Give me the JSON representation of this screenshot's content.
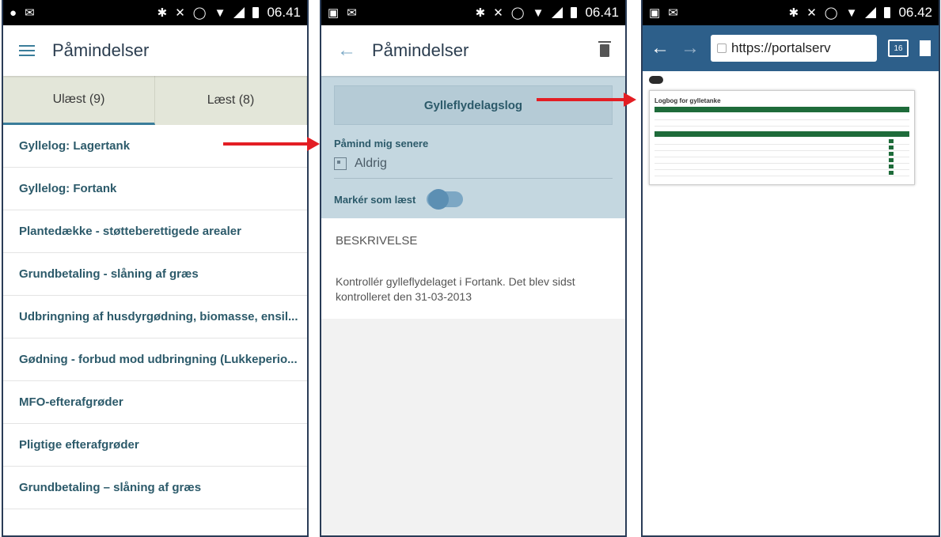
{
  "phone1": {
    "status": {
      "time": "06.41"
    },
    "appbar": {
      "title": "Påmindelser"
    },
    "tabs": [
      {
        "label": "Ulæst (9)"
      },
      {
        "label": "Læst (8)"
      }
    ],
    "items": [
      {
        "label": "Gyllelog: Lagertank"
      },
      {
        "label": "Gyllelog: Fortank"
      },
      {
        "label": "Plantedække - støtteberettigede arealer"
      },
      {
        "label": "Grundbetaling - slåning af græs"
      },
      {
        "label": "Udbringning af husdyrgødning, biomasse, ensil..."
      },
      {
        "label": "Gødning - forbud mod udbringning (Lukkeperio..."
      },
      {
        "label": "MFO-efterafgrøder"
      },
      {
        "label": "Pligtige efterafgrøder"
      },
      {
        "label": "Grundbetaling – slåning af græs"
      }
    ]
  },
  "phone2": {
    "status": {
      "time": "06.41"
    },
    "appbar": {
      "title": "Påmindelser"
    },
    "subject": "Gylleflydelagslog",
    "remind_label": "Påmind mig senere",
    "remind_value": "Aldrig",
    "mark_read_label": "Markér som læst",
    "desc_heading": "BESKRIVELSE",
    "desc_text": "Kontrollér gylleflydelaget i Fortank. Det blev sidst kontrolleret den 31-03-2013"
  },
  "phone3": {
    "status": {
      "time": "06.42"
    },
    "url": "https://portalserv",
    "tab_count": "16",
    "doc_title": "Logbog for gylletanke"
  },
  "colors": {
    "accent": "#3a7d9a",
    "arrow": "#e31e24",
    "browser_bar": "#2d5f8a"
  }
}
